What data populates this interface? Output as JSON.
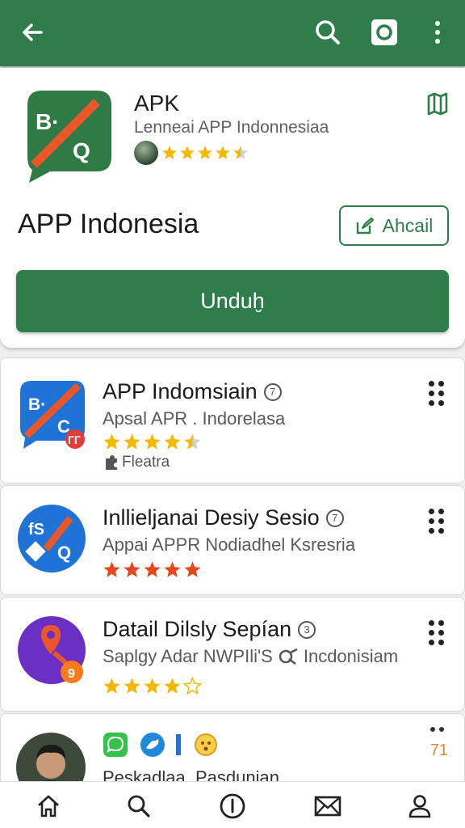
{
  "colors": {
    "brand": "#2e7d4a",
    "star": "#f5b800",
    "star_red": "#e8461e"
  },
  "topbar": {
    "icons": [
      "back-arrow-icon",
      "search-icon",
      "camera-square-icon",
      "more-vertical-icon"
    ]
  },
  "hero": {
    "app_name": "APK",
    "publisher": "Lenneai APP Indonnesiaa",
    "rating": 4.5,
    "title": "APP Indonesia",
    "outline_button": "Ahcail",
    "primary_button": "Unduḫ",
    "icon_letters": "B·",
    "icon_letters2": "Q"
  },
  "cards": [
    {
      "title": "APP Indomsiain",
      "info": "7",
      "subtitle": "Apsal APR . Indorelasa",
      "rating": 4.5,
      "star_color": "#f5b800",
      "extra": "Fleatra",
      "icon_text": "B·",
      "icon_text2": "C",
      "badge": "ГГ"
    },
    {
      "title": "Inllieljanai Desiy Sesio",
      "info": "7",
      "subtitle": "Appai APPR Nodiadhel Ksresria",
      "rating": 5,
      "star_color": "#e8461e",
      "icon_text": "fS",
      "icon_text2": "Q"
    },
    {
      "title": "Datail Dilsly Sepían",
      "info": "3",
      "subtitle": "Saplgy Adar NWPIli'S",
      "subtitle2": "Incdonisiam",
      "rating": 4,
      "star_color": "#f5b800",
      "icon_text": "9"
    },
    {
      "title": "Peskadlaa. Pasdunian",
      "count": "71"
    }
  ],
  "bottom_nav": [
    "home-icon",
    "search-icon",
    "info-icon",
    "mail-icon",
    "profile-icon"
  ]
}
